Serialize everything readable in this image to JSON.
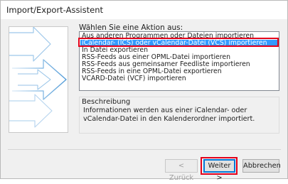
{
  "window": {
    "title": "Import/Export-Assistent"
  },
  "main": {
    "prompt": "Wählen Sie eine Aktion aus:",
    "actions": [
      "Aus anderen Programmen oder Dateien importieren",
      "iCalendar- (ICS) oder vCalendar-Datei (VCS) importieren",
      "In Datei exportieren",
      "RSS-Feeds aus einer OPML-Datei importieren",
      "RSS-Feeds aus gemeinsamer Feedliste importieren",
      "RSS-Feeds in eine OPML-Datei exportieren",
      "VCARD-Datei (VCF) importieren"
    ],
    "selected_action_index": 1,
    "description": {
      "label": "Beschreibung",
      "text": "Informationen werden aus einer iCalendar- oder vCalendar-Datei in den Kalenderordner importiert."
    }
  },
  "buttons": {
    "back_label": "< Zurück",
    "next_label": "Weiter >",
    "cancel_label": "Abbrechen"
  },
  "colors": {
    "selection": "#3399ff",
    "annotation": "#e3001b",
    "arrow": "#3c8fd3"
  }
}
